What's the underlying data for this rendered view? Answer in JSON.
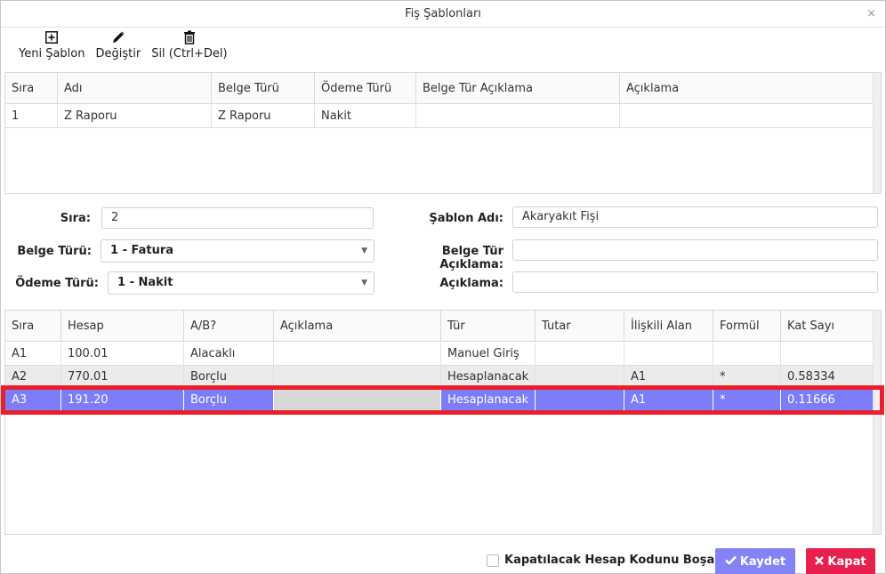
{
  "window": {
    "title": "Fiş Şablonları",
    "close_glyph": "×"
  },
  "toolbar": {
    "new_label": "Yeni Şablon",
    "new_icon": "plus-square-icon",
    "edit_label": "Değiştir",
    "edit_icon": "pencil-icon",
    "delete_label": "Sil (Ctrl+Del)",
    "delete_icon": "trash-icon"
  },
  "templates_grid": {
    "headers": [
      "Sıra",
      "Adı",
      "Belge Türü",
      "Ödeme Türü",
      "Belge Tür Açıklama",
      "Açıklama"
    ],
    "rows": [
      [
        "1",
        "Z Raporu",
        "Z Raporu",
        "Nakit",
        "",
        ""
      ]
    ]
  },
  "form": {
    "sira_label": "Sıra:",
    "sira_value": "2",
    "belge_turu_label": "Belge Türü:",
    "belge_turu_value": "1 - Fatura",
    "odeme_turu_label": "Ödeme Türü:",
    "odeme_turu_value": "1 - Nakit",
    "sablon_adi_label": "Şablon Adı:",
    "sablon_adi_value": "Akaryakıt Fişi",
    "belge_tur_aciklama_label": "Belge Tür Açıklama:",
    "belge_tur_aciklama_value": "",
    "aciklama_label": "Açıklama:",
    "aciklama_value": "",
    "caret": "▼"
  },
  "lines_grid": {
    "headers": [
      "Sıra",
      "Hesap",
      "A/B?",
      "Açıklama",
      "Tür",
      "Tutar",
      "İlişkili Alan",
      "Formül",
      "Kat Sayı"
    ],
    "rows": [
      [
        "A1",
        "100.01",
        "Alacaklı",
        "",
        "Manuel Giriş",
        "",
        "",
        "",
        ""
      ],
      [
        "A2",
        "770.01",
        "Borçlu",
        "",
        "Hesaplanacak",
        "",
        "A1",
        "*",
        "0.58334"
      ],
      [
        "A3",
        "191.20",
        "Borçlu",
        "",
        "Hesaplanacak",
        "",
        "A1",
        "*",
        "0.11666"
      ]
    ],
    "selected_row": 2
  },
  "footer": {
    "checkbox_label": "Kapatılacak Hesap Kodunu Boşalt",
    "save_label": "Kaydet",
    "save_icon": "check-icon",
    "close_label": "Kapat",
    "close_icon": "x-icon",
    "save_color": "#8383f5",
    "close_color": "#e8204e",
    "highlight_color": "#e8202a"
  }
}
